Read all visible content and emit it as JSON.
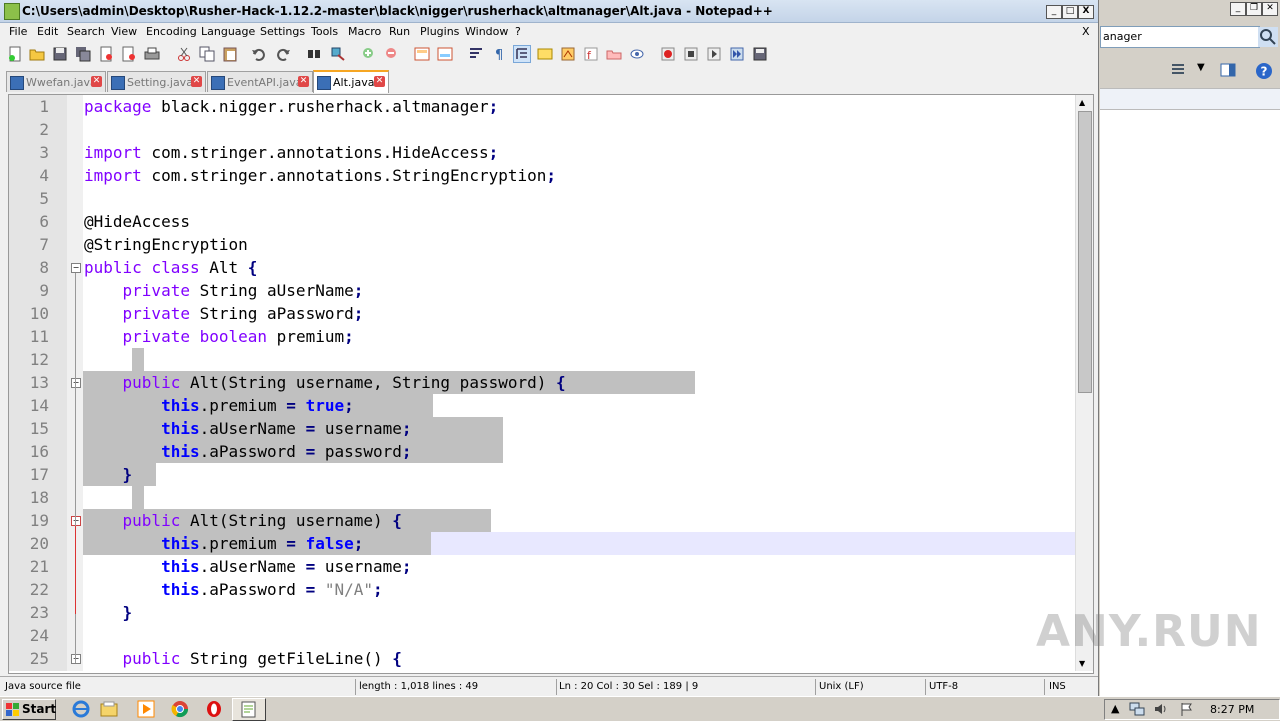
{
  "window": {
    "title": "C:\\Users\\admin\\Desktop\\Rusher-Hack-1.12.2-master\\black\\nigger\\rusherhack\\altmanager\\Alt.java - Notepad++",
    "controls": {
      "minimize": "_",
      "maximize": "□",
      "close": "X"
    },
    "menu_close": "X"
  },
  "menu": [
    "File",
    "Edit",
    "Search",
    "View",
    "Encoding",
    "Language",
    "Settings",
    "Tools",
    "Macro",
    "Run",
    "Plugins",
    "Window",
    "?"
  ],
  "tabs": [
    {
      "label": "Wwefan.java",
      "active": false
    },
    {
      "label": "Setting.java",
      "active": false
    },
    {
      "label": "EventAPI.java",
      "active": false
    },
    {
      "label": "Alt.java",
      "active": true
    }
  ],
  "editor": {
    "lines": [
      {
        "n": "1",
        "text": "package black.nigger.rusherhack.altmanager;"
      },
      {
        "n": "2",
        "text": ""
      },
      {
        "n": "3",
        "text": "import com.stringer.annotations.HideAccess;"
      },
      {
        "n": "4",
        "text": "import com.stringer.annotations.StringEncryption;"
      },
      {
        "n": "5",
        "text": ""
      },
      {
        "n": "6",
        "text": "@HideAccess"
      },
      {
        "n": "7",
        "text": "@StringEncryption"
      },
      {
        "n": "8",
        "text": "public class Alt {"
      },
      {
        "n": "9",
        "text": "    private String aUserName;"
      },
      {
        "n": "10",
        "text": "    private String aPassword;"
      },
      {
        "n": "11",
        "text": "    private boolean premium;"
      },
      {
        "n": "12",
        "text": ""
      },
      {
        "n": "13",
        "text": "    public Alt(String username, String password) {"
      },
      {
        "n": "14",
        "text": "        this.premium = true;"
      },
      {
        "n": "15",
        "text": "        this.aUserName = username;"
      },
      {
        "n": "16",
        "text": "        this.aPassword = password;"
      },
      {
        "n": "17",
        "text": "    }"
      },
      {
        "n": "18",
        "text": ""
      },
      {
        "n": "19",
        "text": "    public Alt(String username) {"
      },
      {
        "n": "20",
        "text": "        this.premium = false;"
      },
      {
        "n": "21",
        "text": "        this.aUserName = username;"
      },
      {
        "n": "22",
        "text": "        this.aPassword = \"N/A\";"
      },
      {
        "n": "23",
        "text": "    }"
      },
      {
        "n": "24",
        "text": ""
      },
      {
        "n": "25",
        "text": "    public String getFileLine() {"
      }
    ]
  },
  "status": {
    "filetype": "Java source file",
    "length": "length : 1,018    lines : 49",
    "position": "Ln : 20    Col : 30    Sel : 189 | 9",
    "eol": "Unix (LF)",
    "encoding": "UTF-8",
    "mode": "INS"
  },
  "right_window": {
    "search_value": "anager"
  },
  "watermark": "ANY.RUN",
  "taskbar": {
    "start_label": "Start",
    "clock": "8:27 PM"
  }
}
